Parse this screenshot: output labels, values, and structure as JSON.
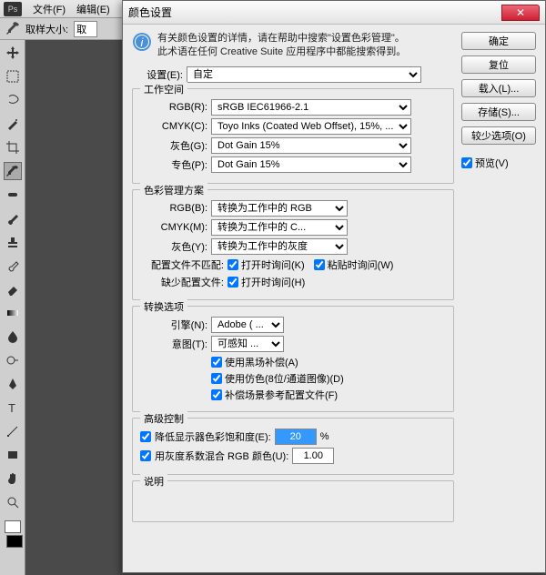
{
  "menubar": {
    "logo": "Ps",
    "file": "文件(F)",
    "edit": "编辑(E)"
  },
  "toolbar": {
    "sample_label": "取样大小:",
    "sample_value": "取"
  },
  "dialog": {
    "title": "颜色设置",
    "info_line1": "有关颜色设置的详情，请在帮助中搜索\"设置色彩管理\"。",
    "info_line2": "此术语在任何 Creative Suite 应用程序中都能搜索得到。",
    "settings_label": "设置(E):",
    "settings_value": "自定",
    "groups": {
      "workspace": {
        "legend": "工作空间",
        "rgb_label": "RGB(R):",
        "rgb_value": "sRGB IEC61966-2.1",
        "cmyk_label": "CMYK(C):",
        "cmyk_value": "Toyo Inks (Coated Web Offset), 15%, ...",
        "gray_label": "灰色(G):",
        "gray_value": "Dot Gain 15%",
        "spot_label": "专色(P):",
        "spot_value": "Dot Gain 15%"
      },
      "policy": {
        "legend": "色彩管理方案",
        "rgb_label": "RGB(B):",
        "rgb_value": "转换为工作中的 RGB",
        "cmyk_label": "CMYK(M):",
        "cmyk_value": "转换为工作中的 C...",
        "gray_label": "灰色(Y):",
        "gray_value": "转换为工作中的灰度",
        "mismatch_label": "配置文件不匹配:",
        "missing_label": "缺少配置文件:",
        "ask_open": "打开时询问(K)",
        "ask_paste": "粘贴时询问(W)",
        "ask_open2": "打开时询问(H)"
      },
      "convert": {
        "legend": "转换选项",
        "engine_label": "引擎(N):",
        "engine_value": "Adobe ( ...",
        "intent_label": "意图(T):",
        "intent_value": "可感知 ...",
        "black_point": "使用黑场补偿(A)",
        "dither": "使用仿色(8位/通道图像)(D)",
        "scene_ref": "补偿场景参考配置文件(F)"
      },
      "advanced": {
        "legend": "高级控制",
        "desat_label": "降低显示器色彩饱和度(E):",
        "desat_value": "20",
        "desat_unit": "%",
        "blend_label": "用灰度系数混合 RGB 颜色(U):",
        "blend_value": "1.00"
      },
      "desc": {
        "legend": "说明"
      }
    },
    "buttons": {
      "ok": "确定",
      "reset": "复位",
      "load": "载入(L)...",
      "save": "存储(S)...",
      "fewer": "较少选项(O)",
      "preview": "预览(V)"
    }
  }
}
